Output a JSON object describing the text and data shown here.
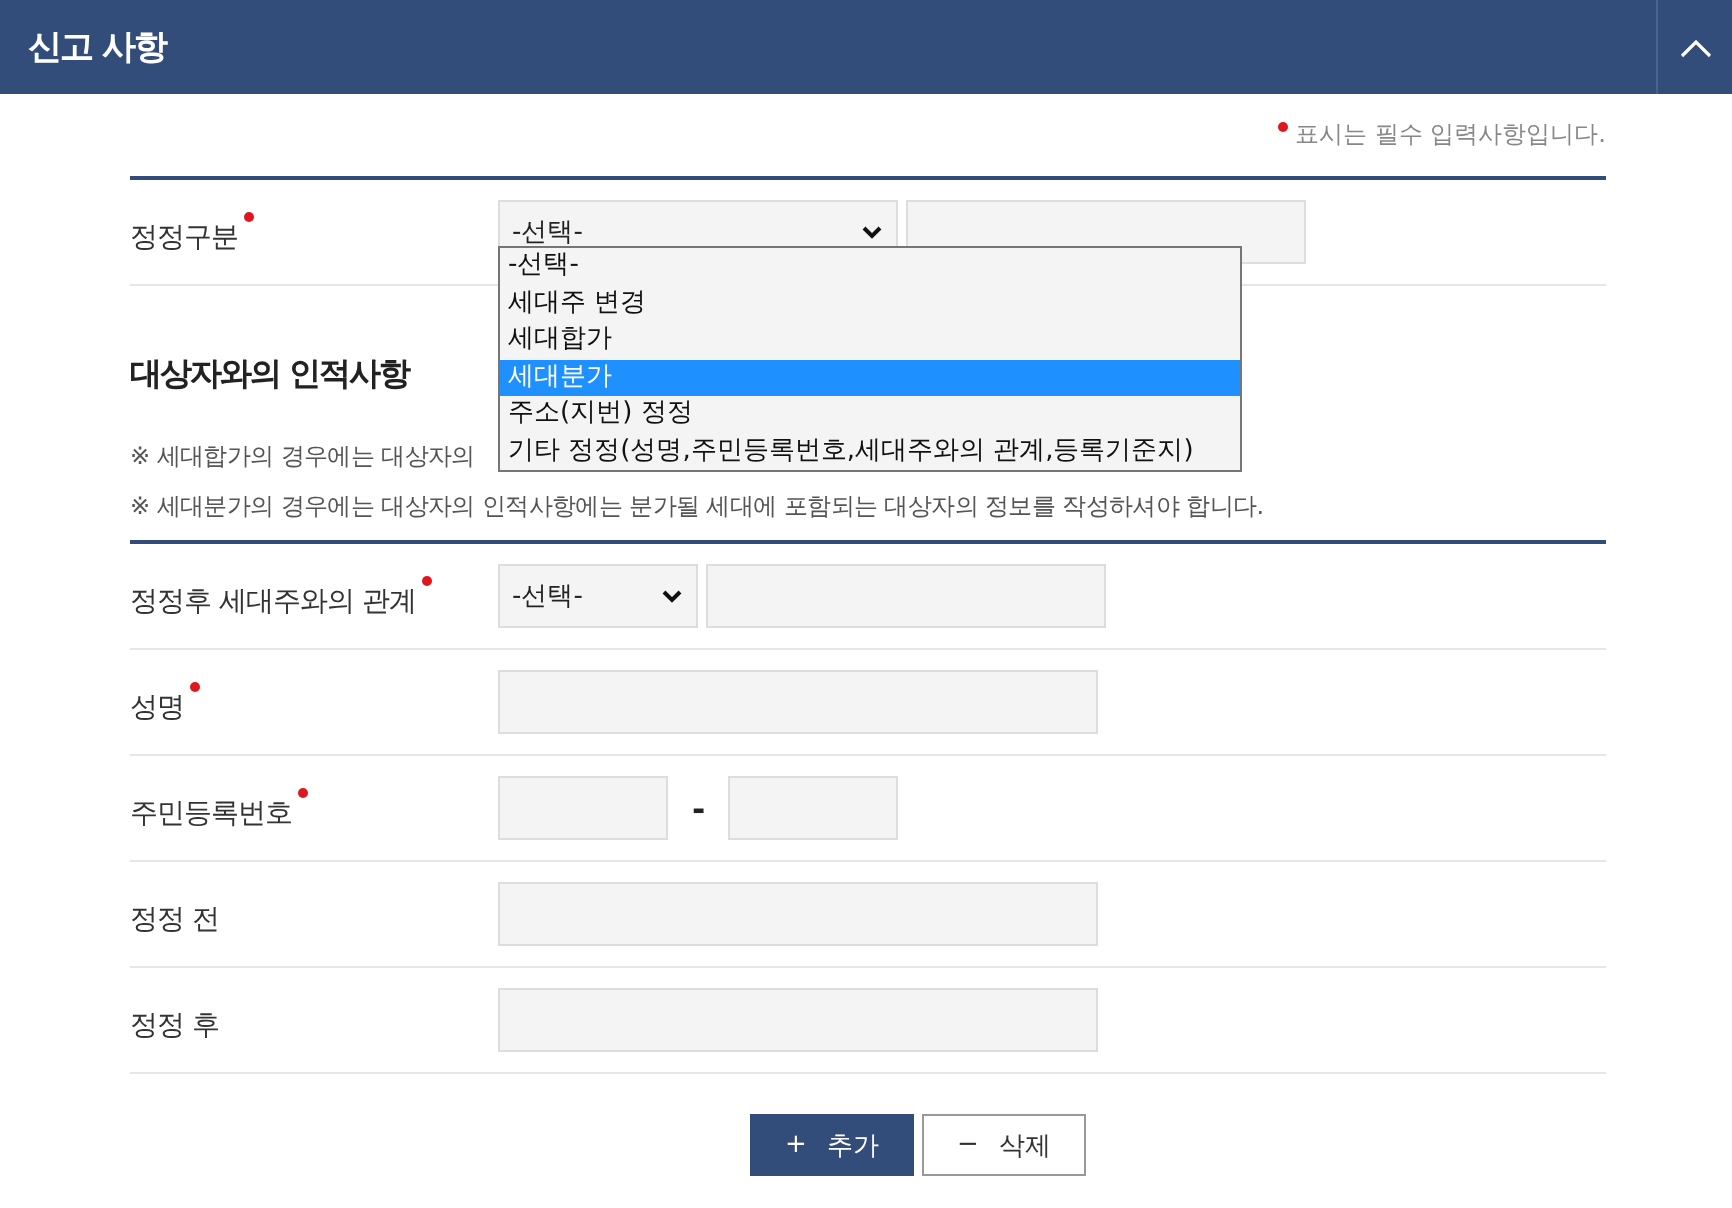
{
  "header": {
    "title": "신고 사항"
  },
  "required_note": "표시는 필수 입력사항입니다.",
  "correction_type": {
    "label": "정정구분",
    "required": true,
    "select": "-선택-",
    "dropdown": {
      "open": true,
      "options": [
        {
          "label": "-선택-",
          "selected": false
        },
        {
          "label": "세대주 변경",
          "selected": false
        },
        {
          "label": "세대합가",
          "selected": false
        },
        {
          "label": "세대분가",
          "selected": true
        },
        {
          "label": "주소(지번) 정정",
          "selected": false
        },
        {
          "label": "기타 정정(성명,주민등록번호,세대주와의 관계,등록기준지)",
          "selected": false
        }
      ]
    }
  },
  "section": {
    "title": "대상자와의 인적사항",
    "notes": [
      "※ 세대합가의 경우에는 대상자의",
      "※ 세대분가의 경우에는 대상자의 인적사항에는 분가될 세대에 포함되는 대상자의 정보를 작성하셔야 합니다."
    ]
  },
  "fields": [
    {
      "kind": "select",
      "label": "정정후 세대주와의 관계",
      "required": true,
      "select": "-선택-"
    },
    {
      "kind": "text",
      "label": "성명",
      "required": true
    },
    {
      "kind": "id",
      "label": "주민등록번호",
      "required": true,
      "separator": "-"
    },
    {
      "kind": "text",
      "label": "정정 전",
      "required": false
    },
    {
      "kind": "text",
      "label": "정정 후",
      "required": false
    }
  ],
  "buttons": [
    {
      "kind": "primary",
      "icon": "+",
      "label": "추가"
    },
    {
      "kind": "secondary",
      "icon": "−",
      "label": "삭제"
    }
  ]
}
